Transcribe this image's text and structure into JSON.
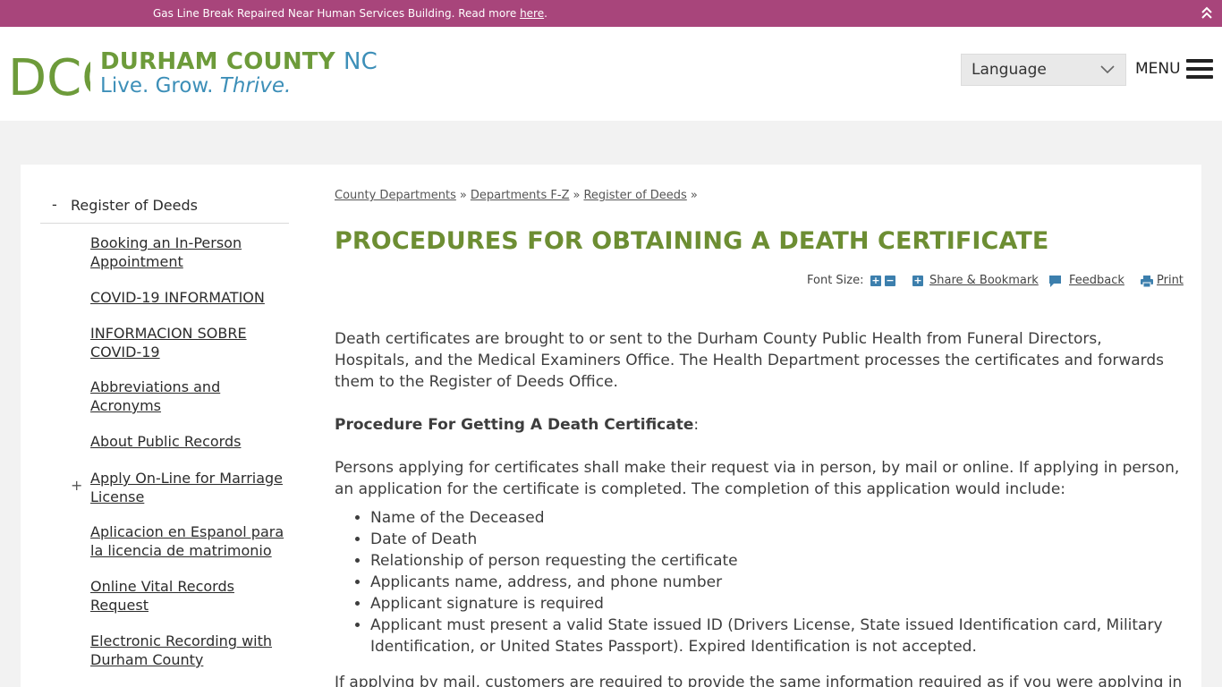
{
  "alert": {
    "text": "Gas Line Break Repaired Near Human Services Building. Read more ",
    "link": "here",
    "suffix": "."
  },
  "header": {
    "logo_letters": "DCO",
    "name_main": "DURHAM COUNTY",
    "name_nc": "NC",
    "tagline_main": "Live. Grow.",
    "tagline_thrive": "Thrive.",
    "language_label": "Language",
    "menu_label": "MENU"
  },
  "sidebar": {
    "current": {
      "marker": "-",
      "label": "Register of Deeds"
    },
    "items": [
      {
        "label": "Booking an In-Person Appointment"
      },
      {
        "label": "COVID-19 INFORMATION"
      },
      {
        "label": "INFORMACION SOBRE COVID-19"
      },
      {
        "label": "Abbreviations and Acronyms"
      },
      {
        "label": "About Public Records"
      },
      {
        "label": "Apply On-Line for Marriage License",
        "expander": "+"
      },
      {
        "label": "Aplicacion en Espanol para la licencia de matrimonio"
      },
      {
        "label": "Online Vital Records Request"
      },
      {
        "label": "Electronic Recording with Durham County"
      }
    ]
  },
  "breadcrumb": [
    {
      "label": "County Departments"
    },
    {
      "label": "Departments F-Z"
    },
    {
      "label": "Register of Deeds"
    }
  ],
  "breadcrumb_sep": "»",
  "page_title": "PROCEDURES FOR OBTAINING A DEATH CERTIFICATE",
  "tools": {
    "font_size_label": "Font Size:",
    "font_plus": "+",
    "font_minus": "−",
    "share_label": "Share & Bookmark",
    "feedback_label": "Feedback",
    "print_label": "Print"
  },
  "content": {
    "p1": "Death certificates are brought to or sent to the Durham County Public Health from Funeral Directors, Hospitals, and the Medical Examiners Office. The Health Department processes the certificates and forwards them to the Register of Deeds Office.",
    "p2_strong": "Procedure For Getting A Death Certificate",
    "p2_suffix": ":",
    "p3": "Persons applying for certificates shall make their request via in person, by mail or online. If applying in person, an application for the certificate is completed. The completion of this application would include:",
    "list": [
      "Name of the Deceased",
      "Date of Death",
      "Relationship of person requesting the certificate",
      "Applicants name, address, and phone number",
      "Applicant signature is required",
      "Applicant must present a valid State issued ID (Drivers License, State issued Identification card, Military Identification, or United States Passport). Expired Identification is not accepted."
    ],
    "p4": "If applying by mail, customers are required to provide the same information required as if you were applying in"
  },
  "colors": {
    "alert_bg": "#a8457b",
    "brand_green": "#6d9b3a",
    "brand_blue": "#3d8fb8",
    "title_green": "#6d8e33",
    "tool_blue": "#3c7fad"
  }
}
